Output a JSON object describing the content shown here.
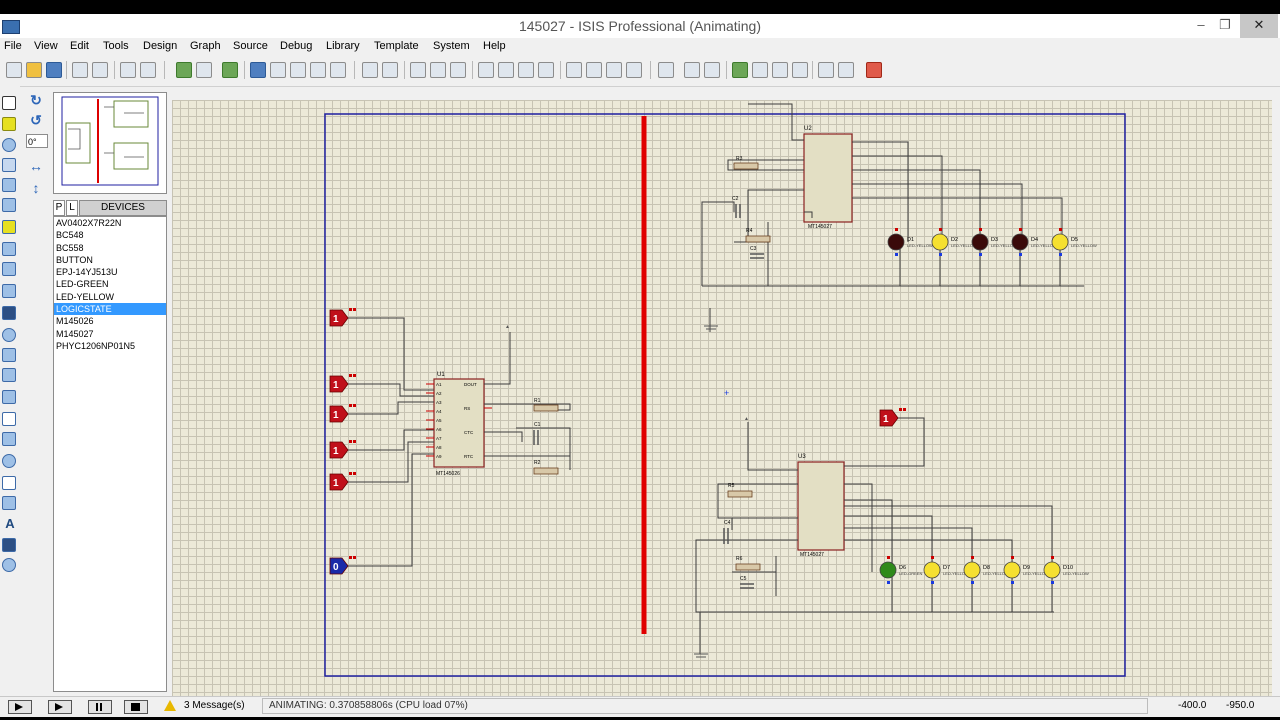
{
  "window": {
    "title": "145027 - ISIS Professional (Animating)",
    "controls": {
      "minimize": "–",
      "maximize": "❐",
      "close": "✕"
    }
  },
  "menubar": [
    "File",
    "View",
    "Edit",
    "Tools",
    "Design",
    "Graph",
    "Source",
    "Debug",
    "Library",
    "Template",
    "System",
    "Help"
  ],
  "rotation": {
    "angle": "0°",
    "rotate_cw": "↻",
    "rotate_ccw": "↺",
    "mirror_h": "↔",
    "mirror_v": "↕"
  },
  "devices": {
    "tab_p": "P",
    "tab_l": "L",
    "title": "DEVICES",
    "items": [
      "AV0402X7R22N",
      "BC548",
      "BC558",
      "BUTTON",
      "EPJ-14YJ513U",
      "LED-GREEN",
      "LED-YELLOW",
      "LOGICSTATE",
      "M145026",
      "M145027",
      "PHYC1206NP01N5"
    ],
    "selected_index": 7
  },
  "left_tool_letter": "A",
  "schematic": {
    "logic_states": [
      "1",
      "1",
      "1",
      "1",
      "1",
      "0",
      "1"
    ],
    "chips": {
      "u1": "U1",
      "u2": "U2",
      "u3": "U3",
      "part_u1": "MT145026",
      "part_u2": "MT145027",
      "part_u3": "MT145027"
    },
    "u1_left_pins": [
      "A1",
      "A2",
      "A3",
      "A4",
      "A5",
      "A6",
      "A7",
      "A8",
      "A9"
    ],
    "u1_right_pins": [
      "DOUT",
      "RS",
      "CTC",
      "RTC"
    ],
    "u2_left_pins": [
      "DIN",
      "R1",
      "C1",
      "RS/C2"
    ],
    "u2_right_pins": [
      "A1",
      "A2",
      "A3",
      "A4",
      "A5",
      "D6",
      "D7",
      "D8",
      "D9",
      "VT"
    ],
    "resistors": [
      "R1",
      "R2",
      "R3",
      "R4",
      "R5",
      "R6"
    ],
    "caps": [
      "C1",
      "C2",
      "C3",
      "C4",
      "C5"
    ],
    "led_labels_top": [
      "D1",
      "D2",
      "D3",
      "D4",
      "D5"
    ],
    "led_labels_bottom": [
      "D6",
      "D7",
      "D8",
      "D9",
      "D10"
    ],
    "led_text_yellow": "LED-YELLOW",
    "led_text_green": "LED-GREEN",
    "text_placeholder": "<TEXT>",
    "colors": {
      "led_on": "#f5e030",
      "led_off": "#3a0a0a",
      "led_green": "#2f8a1a",
      "wire": "#3c3c3c",
      "pin_red": "#cc0000",
      "pin_blue": "#1a3ae0",
      "divider": "#e00000",
      "sheet_border": "#1f1fa0",
      "logic_red": "#c0101a",
      "logic_blue": "#1a2aa8"
    }
  },
  "status": {
    "messages": "3 Message(s)",
    "animating": "ANIMATING: 0.370858806s (CPU load 07%)",
    "x": "-400.0",
    "y": "-950.0"
  }
}
